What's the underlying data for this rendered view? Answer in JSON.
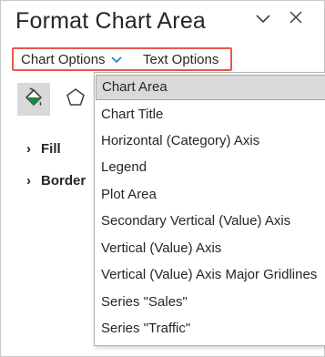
{
  "pane": {
    "title": "Format Chart Area",
    "collapse_icon": "chevron-down-icon",
    "close_icon": "close-icon"
  },
  "options": {
    "chart_options_label": "Chart Options",
    "text_options_label": "Text Options",
    "highlight_color": "#e8584f"
  },
  "tabs": {
    "fill_line_icon": "paint-bucket-icon",
    "effects_icon": "pentagon-icon"
  },
  "sections": {
    "fill_label": "Fill",
    "border_label": "Border"
  },
  "dropdown": {
    "selected": "Chart Area",
    "items": [
      "Chart Area",
      "Chart Title",
      "Horizontal (Category) Axis",
      "Legend",
      "Plot Area",
      "Secondary Vertical (Value) Axis",
      "Vertical (Value) Axis",
      "Vertical (Value) Axis Major Gridlines",
      "Series \"Sales\"",
      "Series \"Traffic\""
    ]
  }
}
